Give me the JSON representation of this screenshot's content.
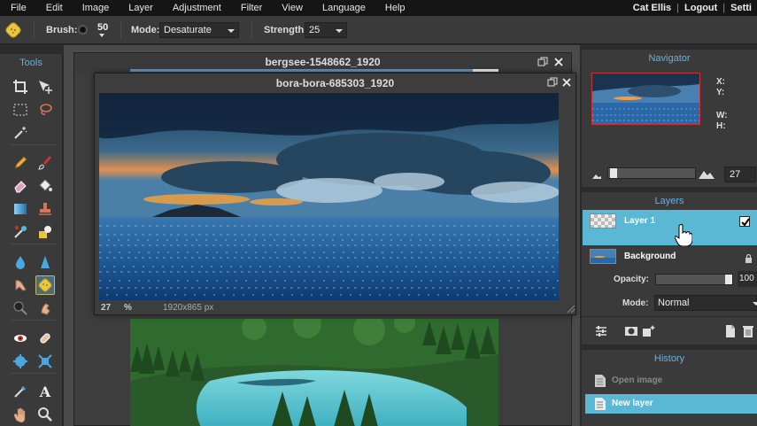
{
  "menubar": {
    "items": [
      "File",
      "Edit",
      "Image",
      "Layer",
      "Adjustment",
      "Filter",
      "View",
      "Language",
      "Help"
    ],
    "user": "Cat Ellis",
    "logout": "Logout",
    "settings": "Setti",
    "separator": "|"
  },
  "options": {
    "active_tool_icon": "sponge-icon",
    "brush_label": "Brush:",
    "brush_size": "50",
    "mode_label": "Mode:",
    "mode_value": "Desaturate",
    "strength_label": "Strength:",
    "strength_value": "25"
  },
  "tools": {
    "title": "Tools",
    "items": [
      "crop-icon",
      "move-icon",
      "marquee-icon",
      "lasso-icon",
      "magic-wand-icon",
      "pencil-icon",
      "brush-icon",
      "eraser-icon",
      "bucket-icon",
      "gradient-icon",
      "stamp-icon",
      "color-replace-icon",
      "drawing-icon",
      "blur-icon",
      "sharpen-icon",
      "smudge-icon",
      "sponge-icon",
      "dodge-icon",
      "burn-icon",
      "red-eye-icon",
      "spot-heal-icon",
      "bloat-icon",
      "pinch-icon",
      "color-picker-icon",
      "text-icon",
      "hand-icon",
      "zoom-icon"
    ],
    "active": "sponge-icon"
  },
  "documents": {
    "back": {
      "title": "bergsee-1548662_1920",
      "progress": 0.93
    },
    "front": {
      "title": "bora-bora-685303_1920",
      "zoom": "27",
      "zoom_unit": "%",
      "size": "1920x865 px"
    }
  },
  "navigator": {
    "title": "Navigator",
    "x_label": "X:",
    "y_label": "Y:",
    "w_label": "W:",
    "h_label": "H:",
    "zoom_value": "27",
    "zoom_slider_level": 0.02
  },
  "layers": {
    "title": "Layers",
    "items": [
      {
        "name": "Layer 1",
        "selected": true,
        "visible": true
      },
      {
        "name": "Background",
        "selected": false,
        "locked": true
      }
    ],
    "opacity_label": "Opacity:",
    "opacity_value": "100",
    "mode_label": "Mode:",
    "mode_value": "Normal"
  },
  "history": {
    "title": "History",
    "items": [
      {
        "label": "Open image",
        "selected": false
      },
      {
        "label": "New layer",
        "selected": true
      }
    ]
  },
  "colors": {
    "accent": "#6ab0de",
    "selection": "#5bb8d4",
    "panel": "#3a3a3a",
    "menubar": "#151515"
  }
}
